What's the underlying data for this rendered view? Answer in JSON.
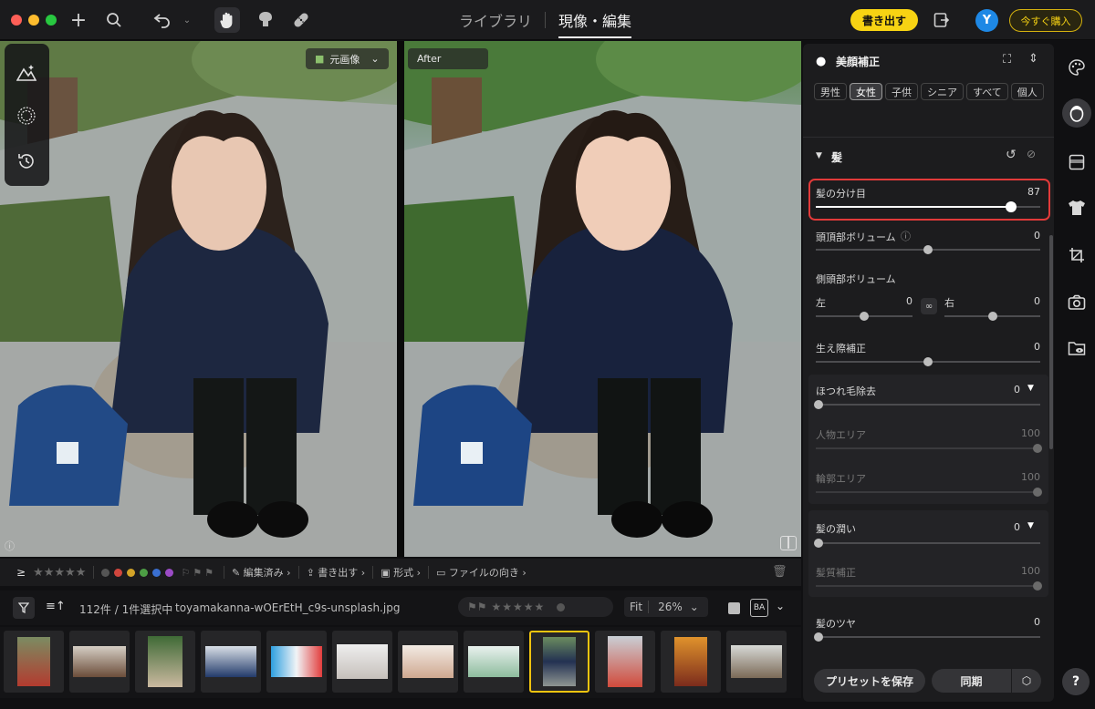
{
  "topbar": {
    "tabs": [
      {
        "label": "ライブラリ",
        "active": false
      },
      {
        "label": "現像・編集",
        "active": true
      }
    ],
    "export_label": "書き出す",
    "avatar_initial": "Y",
    "buy_label": "今すぐ購入"
  },
  "viewer": {
    "before_label": "元画像",
    "after_label": "After"
  },
  "filmstrip_toolbar": {
    "filter_icon": "≥",
    "edited_label": "編集済み",
    "export_label": "書き出す",
    "format_label": "形式",
    "orientation_label": "ファイルの向き",
    "label_colors": [
      "#d0463d",
      "#d2a328",
      "#4d9e45",
      "#3a6fd0",
      "#9b4bc6"
    ]
  },
  "filmstrip_info": {
    "count_text": "112件 / 1件選択中",
    "filename": "toyamakanna-wOErEtH_c9s-unsplash.jpg",
    "fit_label": "Fit",
    "zoom_value": "26%"
  },
  "panel": {
    "title": "美顔補正",
    "chips": [
      {
        "label": "男性",
        "active": false
      },
      {
        "label": "女性",
        "active": true
      },
      {
        "label": "子供",
        "active": false
      },
      {
        "label": "シニア",
        "active": false
      },
      {
        "label": "すべて",
        "active": false
      },
      {
        "label": "個人",
        "active": false
      }
    ],
    "section_title": "髪",
    "sliders": {
      "parting": {
        "label": "髪の分け目",
        "value": "87",
        "fraction": 0.87
      },
      "crown_volume": {
        "label": "頭頂部ボリューム",
        "value": "0",
        "fraction": 0.5
      },
      "side_volume": {
        "label": "側頭部ボリューム"
      },
      "side_left": {
        "label": "左",
        "value": "0",
        "fraction": 0.5
      },
      "side_right": {
        "label": "右",
        "value": "0",
        "fraction": 0.5
      },
      "hairline": {
        "label": "生え際補正",
        "value": "0",
        "fraction": 0.5
      },
      "flyaway": {
        "label": "ほつれ毛除去",
        "value": "0",
        "fraction": 0.0
      },
      "person_area": {
        "label": "人物エリア",
        "value": "100",
        "fraction": 1.0
      },
      "contour_area": {
        "label": "輪郭エリア",
        "value": "100",
        "fraction": 1.0
      },
      "moisture": {
        "label": "髪の潤い",
        "value": "0",
        "fraction": 0.0
      },
      "texture": {
        "label": "髪質補正",
        "value": "100",
        "fraction": 1.0
      },
      "shine": {
        "label": "髪のツヤ",
        "value": "0",
        "fraction": 0.0
      }
    },
    "save_preset_label": "プリセットを保存",
    "sync_label": "同期"
  },
  "icons": {
    "help": "?"
  }
}
